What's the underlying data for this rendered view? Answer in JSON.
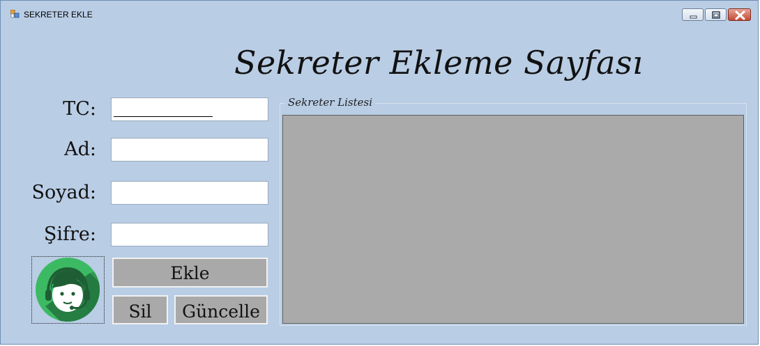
{
  "window": {
    "title": "SEKRETER EKLE",
    "controls": {
      "minimize": "minimize-icon",
      "maximize": "maximize-icon",
      "close": "close-icon"
    }
  },
  "page": {
    "heading": "Sekreter Ekleme Sayfası"
  },
  "form": {
    "fields": [
      {
        "label": "TC:",
        "value": ""
      },
      {
        "label": "Ad:",
        "value": ""
      },
      {
        "label": "Soyad:",
        "value": ""
      },
      {
        "label": "Şifre:",
        "value": ""
      }
    ],
    "logo": "secretary-headset-icon"
  },
  "buttons": {
    "add": "Ekle",
    "delete": "Sil",
    "update": "Güncelle"
  },
  "list": {
    "title": "Sekreter Listesi"
  },
  "colors": {
    "window_background": "#b9cde5",
    "button_background": "#a9a9a9",
    "grid_background": "#aaaaaa",
    "logo_green": "#3cba63"
  }
}
